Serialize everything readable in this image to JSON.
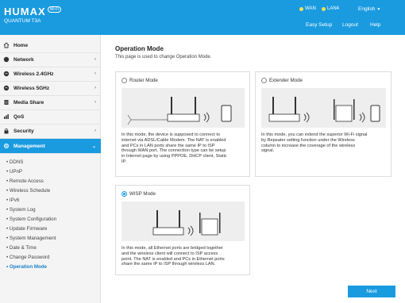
{
  "header": {
    "brand": "HUMAX",
    "brand_badge": "Wi-Fi",
    "model": "QUANTUM T3A",
    "status_wan": "WAN",
    "status_lan": "LAN4",
    "language": "English",
    "nav": [
      "Easy Setup",
      "Logout",
      "Help"
    ],
    "status_color": "#f5e05a",
    "brand_color": "#1a9be0"
  },
  "sidebar": {
    "menu": [
      {
        "label": "Home",
        "icon": "home-icon"
      },
      {
        "label": "Network",
        "icon": "globe-icon"
      },
      {
        "label": "Wireless 2.4GHz",
        "icon": "wifi-icon"
      },
      {
        "label": "Wireless 5GHz",
        "icon": "wifi-icon"
      },
      {
        "label": "Media Share",
        "icon": "storage-icon"
      },
      {
        "label": "QoS",
        "icon": "bar-chart-icon"
      },
      {
        "label": "Security",
        "icon": "lock-icon"
      },
      {
        "label": "Management",
        "icon": "gear-icon"
      }
    ],
    "submenu": [
      "DDNS",
      "UPnP",
      "Remote Access",
      "Wireless Schedule",
      "IPv6",
      "System Log",
      "System Configuration",
      "Update Firmware",
      "System Management",
      "Date & Time",
      "Change Password",
      "Operation Mode"
    ]
  },
  "main": {
    "title": "Operation Mode",
    "description": "This page is used to change Operation Mode.",
    "modes": [
      {
        "label": "Router Mode",
        "selected": false,
        "lines": [
          "In this mode, the device is supposed to connect to",
          "internet via ADSL/Cable Modem. The NAT is enabled",
          "and PCs in LAN ports share the same IP to ISP",
          "through WAN port. The connection type can be setup",
          "in Internet page by using PPPOE, DHCP client, Static",
          "IP."
        ]
      },
      {
        "label": "Extender Mode",
        "selected": false,
        "lines": [
          "In this mode, you can extend the superior Wi-Fi signal",
          "by Repeater setting function under the Wireless",
          "column to increase the coverage of the wireless",
          "signal."
        ]
      },
      {
        "label": "WISP Mode",
        "selected": true,
        "lines": [
          "In this mode, all Ethernet ports are bridged together",
          "and the wireless client will connect to ISP access",
          "point. The NAT is enabled and PCs in Ethernet ports",
          "share the same IP to ISP through wireless LAN."
        ]
      }
    ],
    "next_label": "Next"
  }
}
